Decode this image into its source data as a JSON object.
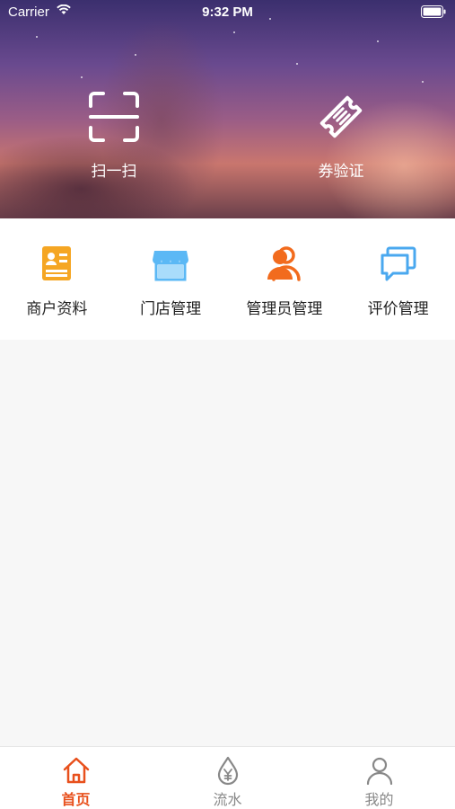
{
  "status_bar": {
    "carrier": "Carrier",
    "time": "9:32 PM"
  },
  "hero": {
    "actions": [
      {
        "label": "扫一扫",
        "icon": "scan-icon"
      },
      {
        "label": "券验证",
        "icon": "ticket-icon"
      }
    ]
  },
  "grid": {
    "items": [
      {
        "label": "商户资料",
        "icon": "merchant-profile-icon",
        "color": "#f5a623"
      },
      {
        "label": "门店管理",
        "icon": "store-icon",
        "color": "#5bb8f5"
      },
      {
        "label": "管理员管理",
        "icon": "admin-users-icon",
        "color": "#f26b1d"
      },
      {
        "label": "评价管理",
        "icon": "comments-icon",
        "color": "#4aa8ef"
      }
    ]
  },
  "tabbar": {
    "tabs": [
      {
        "label": "首页",
        "icon": "home-icon",
        "active": true
      },
      {
        "label": "流水",
        "icon": "money-drop-icon",
        "active": false
      },
      {
        "label": "我的",
        "icon": "user-icon",
        "active": false
      }
    ],
    "active_color": "#e8501c",
    "inactive_color": "#888888"
  }
}
